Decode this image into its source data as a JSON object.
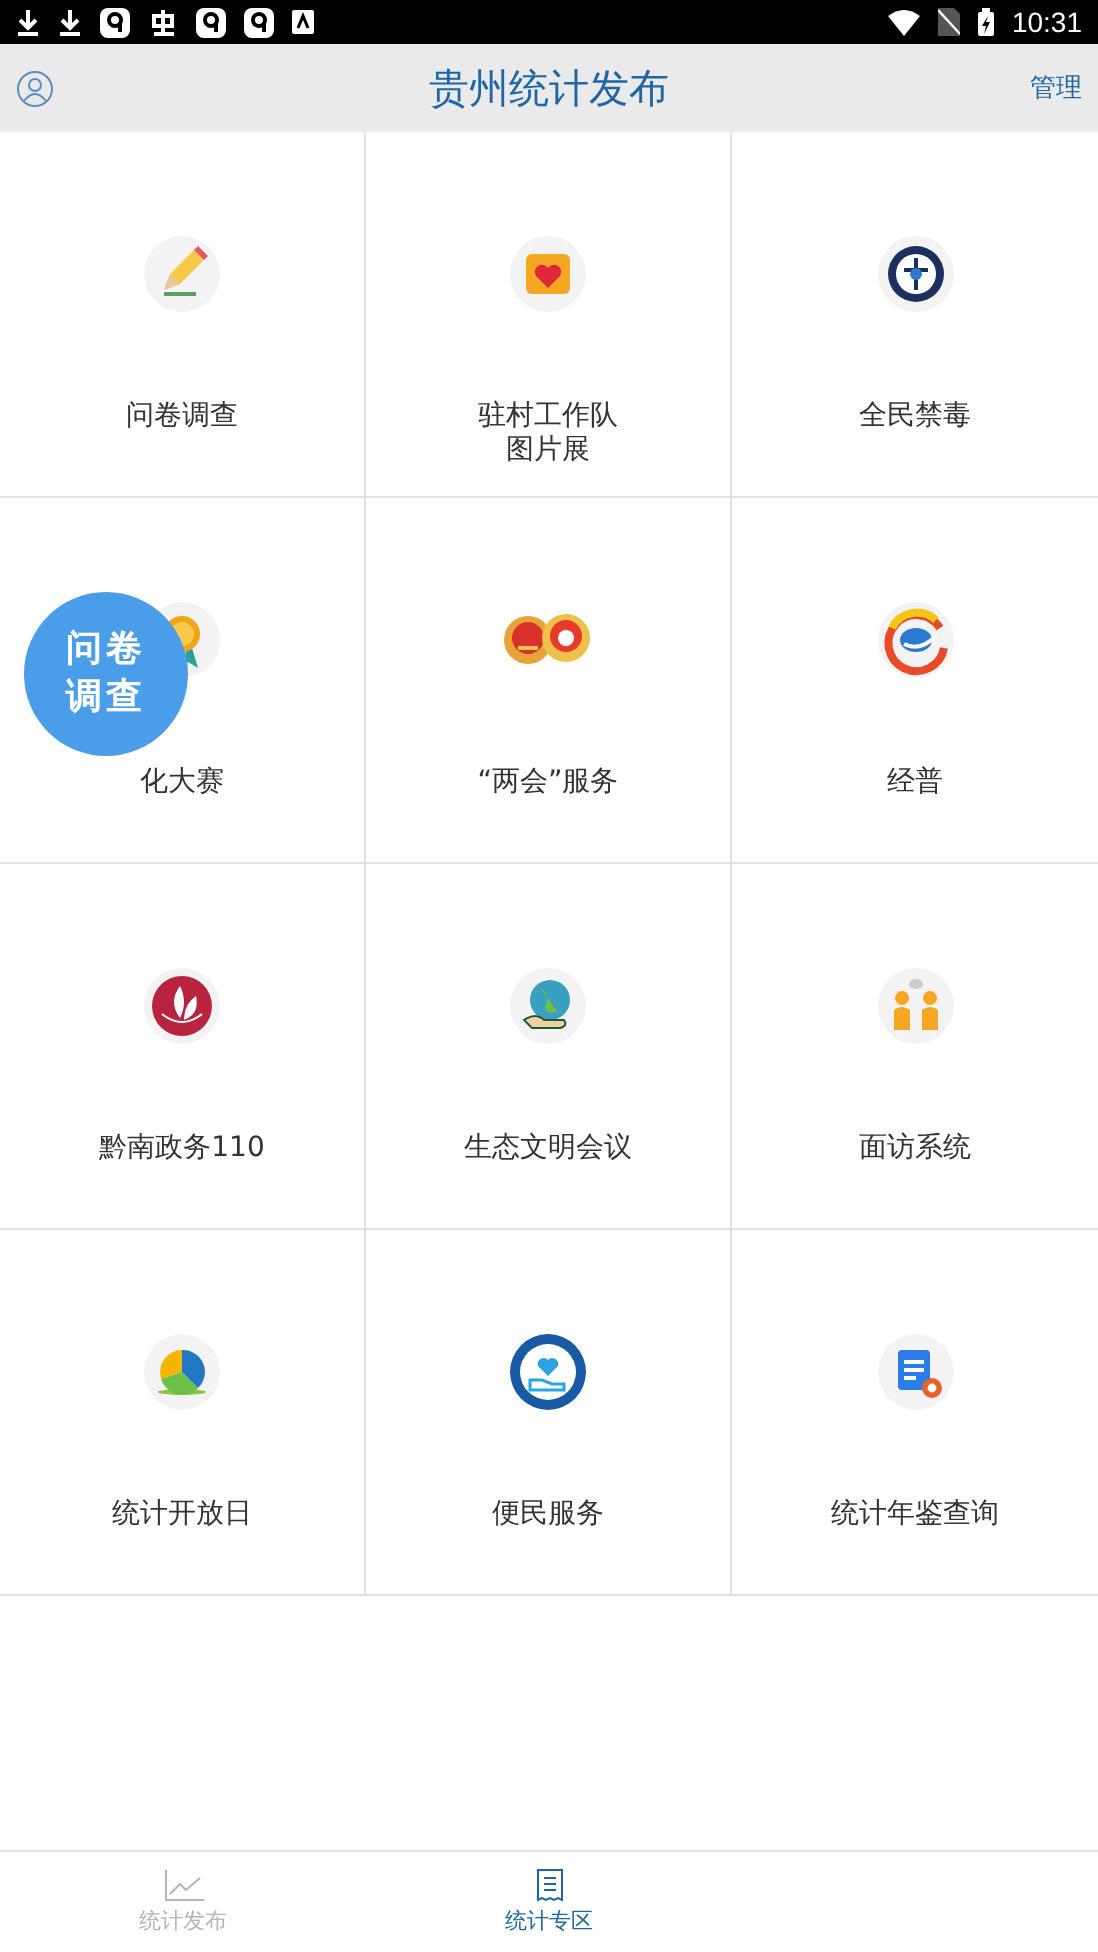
{
  "status_bar": {
    "time": "10:31"
  },
  "header": {
    "title": "贵州统计发布",
    "action": "管理"
  },
  "tiles": [
    {
      "label": "问卷调查"
    },
    {
      "label": "驻村工作队图片展"
    },
    {
      "label": "全民禁毒"
    },
    {
      "label": "化大赛"
    },
    {
      "label": "“两会”服务"
    },
    {
      "label": "经普"
    },
    {
      "label": "黔南政务110"
    },
    {
      "label": "生态文明会议"
    },
    {
      "label": "面访系统"
    },
    {
      "label": "统计开放日"
    },
    {
      "label": "便民服务"
    },
    {
      "label": "统计年鉴查询"
    }
  ],
  "floating_button": {
    "label": "问卷调查"
  },
  "tabs": [
    {
      "label": "统计发布",
      "selected": false
    },
    {
      "label": "统计专区",
      "selected": true
    }
  ]
}
